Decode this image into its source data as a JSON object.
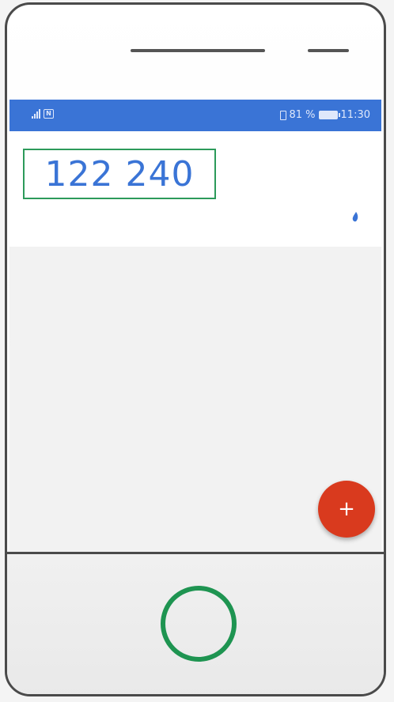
{
  "status_bar": {
    "battery": "81 %",
    "time": "11:30",
    "nfc_label": "N"
  },
  "counter": {
    "value": "122 240"
  },
  "fab": {
    "label": "+"
  },
  "colors": {
    "status_bar": "#3a74d6",
    "counter_text": "#3a74d6",
    "counter_border": "#2c9a5a",
    "fab": "#d93a1e",
    "home_ring": "#1e9451"
  },
  "icons": [
    "signal-icon",
    "nfc-icon",
    "vibrate-icon",
    "battery-icon",
    "drop-icon",
    "plus-icon"
  ]
}
